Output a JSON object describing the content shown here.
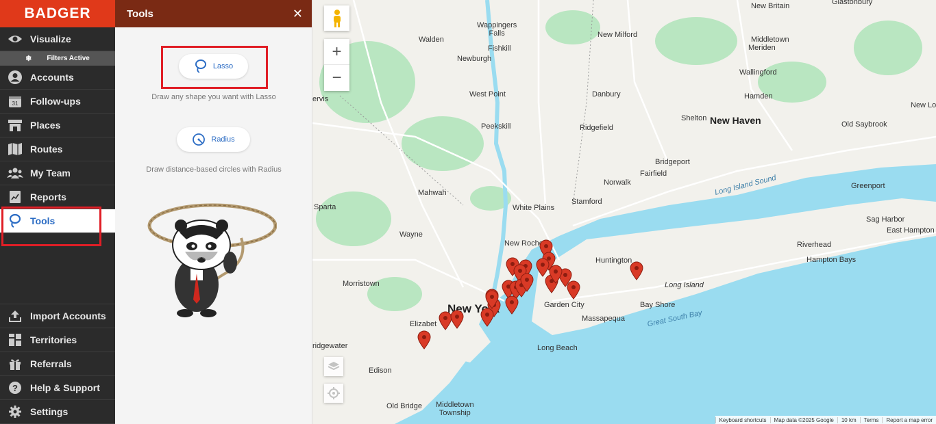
{
  "brand": {
    "logo": "BADGER"
  },
  "sidebar": {
    "items": [
      {
        "label": "Visualize",
        "icon": "eye-icon"
      },
      {
        "label": "Accounts",
        "icon": "user-circle-icon"
      },
      {
        "label": "Follow-ups",
        "icon": "calendar-icon"
      },
      {
        "label": "Places",
        "icon": "store-icon"
      },
      {
        "label": "Routes",
        "icon": "route-map-icon"
      },
      {
        "label": "My Team",
        "icon": "team-icon"
      },
      {
        "label": "Reports",
        "icon": "report-icon"
      },
      {
        "label": "Tools",
        "icon": "lasso-icon"
      }
    ],
    "filters_active": "Filters Active",
    "bottom_items": [
      {
        "label": "Import Accounts",
        "icon": "upload-icon"
      },
      {
        "label": "Territories",
        "icon": "territory-grid-icon"
      },
      {
        "label": "Referrals",
        "icon": "gift-icon"
      },
      {
        "label": "Help & Support",
        "icon": "help-icon"
      },
      {
        "label": "Settings",
        "icon": "gear-icon"
      }
    ],
    "active_item": "Tools"
  },
  "panel": {
    "title": "Tools",
    "close": "✕",
    "lasso": {
      "label": "Lasso",
      "description": "Draw any shape you want with Lasso"
    },
    "radius": {
      "label": "Radius",
      "description": "Draw distance-based circles with Radius"
    }
  },
  "map": {
    "labels": {
      "new_york": "New York",
      "new_haven": "New Haven",
      "newburgh": "Newburgh",
      "walden": "Walden",
      "wappingers_falls": "Wappingers\nFalls",
      "fishkill": "Fishkill",
      "west_point": "West Point",
      "peekskill": "Peekskill",
      "danbury": "Danbury",
      "ridgefield": "Ridgefield",
      "new_milford": "New Milford",
      "middletown": "Middletown",
      "meriden": "Meriden",
      "wallingford": "Wallingford",
      "hamden": "Hamden",
      "new_britain": "New Britain",
      "glastonbury": "Glastonbury",
      "shelton": "Shelton",
      "bridgeport": "Bridgeport",
      "fairfield": "Fairfield",
      "norwalk": "Norwalk",
      "stamford": "Stamford",
      "white_plains": "White Plains",
      "new_rochelle": "New Rochelle",
      "huntington": "Huntington",
      "garden_city": "Garden City",
      "massapequa": "Massapequa",
      "long_beach": "Long Beach",
      "bay_shore": "Bay Shore",
      "long_island": "Long Island",
      "mahwah": "Mahwah",
      "wayne": "Wayne",
      "morristown": "Morristown",
      "elizabeth": "Elizabet",
      "edison": "Edison",
      "old_bridge": "Old Bridge",
      "middletown_township": "Middletown\nTownship",
      "sparta": "Sparta",
      "old_saybrook": "Old Saybrook",
      "new_london": "New Lon",
      "greenport": "Greenport",
      "riverhead": "Riverhead",
      "hampton_bays": "Hampton Bays",
      "sag_harbor": "Sag Harbor",
      "east_hampton": "East Hampton",
      "long_island_sound": "Long Island Sound",
      "great_south_bay": "Great South Bay",
      "bridgewater": "ridgewater",
      "jervis": "ervis"
    },
    "attribution": [
      "Keyboard shortcuts",
      "Map data ©2025 Google",
      "10 km",
      "Terms",
      "Report a map error"
    ],
    "zoom_in": "+",
    "zoom_out": "−",
    "pin_color": "#d93a26",
    "land_color": "#f2f1ec",
    "water_color": "#9adcf0",
    "green_color": "#b9e6c1"
  }
}
